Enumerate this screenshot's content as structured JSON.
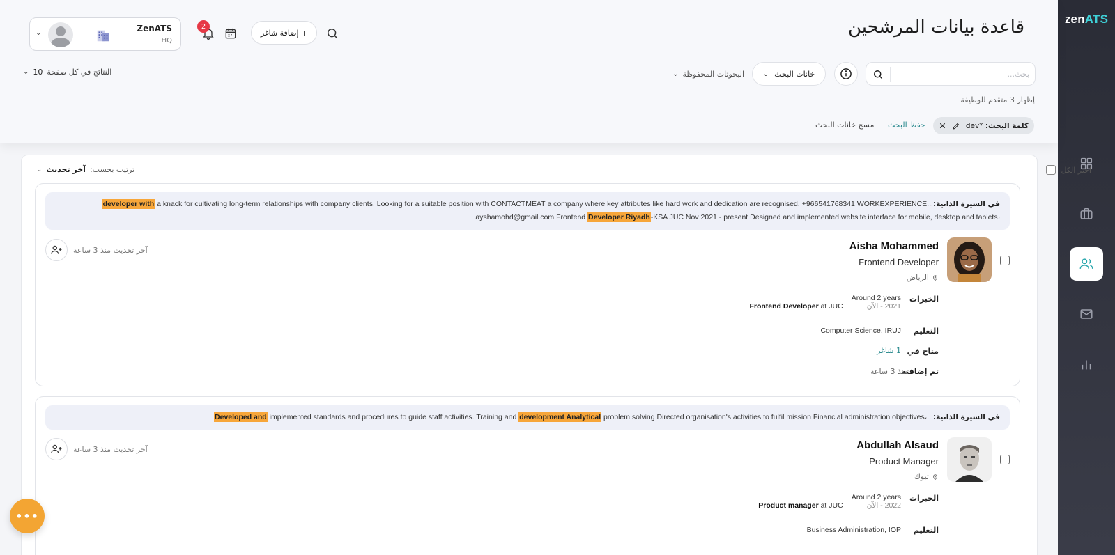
{
  "app": {
    "brand_main": "zen",
    "brand_accent": "ATS",
    "accent_color": "#3fd0d7",
    "highlight_color": "#f7a63a"
  },
  "header": {
    "title": "قاعدة بيانات المرشحين",
    "org_name": "ZenATS",
    "org_sub": "HQ",
    "notification_count": "2",
    "add_vacancy_label": "+ إضافة شاغر"
  },
  "search": {
    "placeholder": "بحث...",
    "fields_label": "خانات البحث",
    "saved_label": "البحوثات المحفوظة",
    "results_per_page_label": "النتائج في كل صفحة",
    "results_per_page_value": "10",
    "showing_text": "إظهار 3 متقدم للوظيفة",
    "chip_key": "كلمة البحث:",
    "chip_value": "dev*",
    "save_search_label": "حفظ البحث",
    "clear_fields_label": "مسح خانات البحث"
  },
  "list": {
    "select_all_label": "اختر الكل",
    "sort_label": "ترتيب بحسب:",
    "sort_value": "آخر تحديث"
  },
  "labels": {
    "cv_prefix": "في السيرة الذاتية:",
    "experience": "الخبرات",
    "education": "التعليم",
    "available_in": "متاح في",
    "added": "تم إضافته",
    "at": "at"
  },
  "candidates": [
    {
      "snippet_line1_pre": "...",
      "snippet_hl1": "developer with",
      "snippet_line1_post": " a knack for cultivating long-term relationships with company clients. Looking for a suitable position with CONTACTMEAT a company where key attributes like hard work and dedication are recognised. +966541768341 WORKEXPERIENCE",
      "snippet_line2_pre": "ayshamohd@gmail.com Frontend ",
      "snippet_hl2": "Developer Riyadh",
      "snippet_line2_post": "-KSA JUC Nov 2021 - present Designed and implemented website interface for mobile, desktop and tablets",
      "snippet_end": "،",
      "name": "Aisha Mohammed",
      "title": "Frontend Developer",
      "location": "الرياض",
      "updated": "آخر تحديث منذ 3 ساعة",
      "exp_duration": "Around 2 years",
      "exp_range": "2021 - الآن",
      "exp_role": "Frontend Developer",
      "exp_company": "JUC",
      "education": "Computer Science, IRUJ",
      "available": "1 شاغر",
      "added": "منذ 3 ساعة"
    },
    {
      "snippet_line1_pre": "...",
      "snippet_hl1": "Developed and",
      "snippet_line1_mid": " implemented standards and procedures to guide staff activities. Training and ",
      "snippet_hl2": "development Analytical",
      "snippet_line1_post": " problem solving Directed organisation's activities to fulfil mission Financial administration objectives",
      "snippet_end": "،",
      "name": "Abdullah Alsaud",
      "title": "Product Manager",
      "location": "تبوك",
      "updated": "آخر تحديث منذ 3 ساعة",
      "exp_duration": "Around 2 years",
      "exp_range": "2022 - الآن",
      "exp_role": "Product manager",
      "exp_company": "JUC",
      "education": "Business Administration, IOP"
    }
  ],
  "fab_label": "•••"
}
